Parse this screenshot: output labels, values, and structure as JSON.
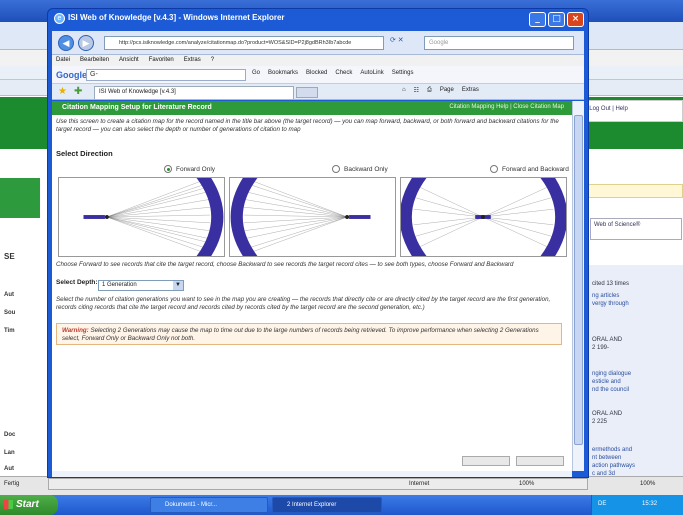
{
  "background": {
    "left_labels": [
      "SE",
      "Aut",
      "Sou",
      "Tim",
      "Doc",
      "Lan",
      "Aut"
    ],
    "right_nav": "| Log Out | Help",
    "web_of_science": "Web of Science®",
    "right_text": [
      "cited 13 times",
      "ng articles",
      "vergy through",
      "ORAL AND",
      "2 199-",
      "nging dialogue",
      "esticle and",
      "nd the council",
      "ORAL AND",
      "2 225",
      "ermethods and",
      "nt between",
      "action pathways",
      "c and 3d"
    ],
    "status_left": "Fertig",
    "status_zoom": "100%"
  },
  "popup": {
    "title": "ISI Web of Knowledge [v.4.3] - Windows Internet Explorer",
    "address": "http://pcs.isiknowledge.com/analyze/citationmap.do?product=WOS&SID=P2j8gdBRh3Ib7abcde",
    "search_placeholder": "Google",
    "menu": [
      "Datei",
      "Bearbeiten",
      "Ansicht",
      "Favoriten",
      "Extras",
      "?"
    ],
    "google_box": "G-",
    "google_items": [
      "Go",
      "Bookmarks",
      "Blocked",
      "Check",
      "AutoLink",
      "Settings"
    ],
    "tab_label": "ISI Web of Knowledge [v.4.3]",
    "tab_tools": [
      "Page",
      "Extras"
    ],
    "status_internet": "Internet",
    "status_zoom": "100%"
  },
  "citation_map": {
    "header_title": "Citation Mapping Setup for Literature Record",
    "header_links": "Citation Mapping Help | Close Citation Map",
    "intro": "Use this screen to create a citation map for the record named in the title bar above (the target record) — you can map forward, backward, or both forward and backward citations for the target record — you can also select the depth or number of generations of citation to map",
    "select_direction": "Select Direction",
    "options": {
      "forward": "Forward Only",
      "backward": "Backward Only",
      "both": "Forward and Backward"
    },
    "selected_direction": "forward",
    "choose_text": "Choose Forward to see records that cite the target record, choose Backward to see records the target record cites — to see both types, choose Forward and Backward",
    "select_depth_label": "Select Depth:",
    "depth_value": "1 Generation",
    "depth_text": "Select the number of citation generations you want to see in the map you are creating — the records that directly cite or are directly cited by the target record are the first generation, records citing records that cite the target record and records cited by records cited by the target record are the second generation, etc.)",
    "warning_label": "Warning:",
    "warning_text": "Selecting 2 Generations may cause the map to time out due to the large numbers of records being retrieved. To improve performance when selecting 2 Generations select, Forward Only or Backward Only not both."
  },
  "taskbar": {
    "start": "Start",
    "tasks": [
      "Dokument1 - Micr...",
      "2 Internet Explorer"
    ],
    "lang": "DE",
    "clock": "15:32"
  },
  "colors": {
    "accent_green": "#2f9a3a",
    "window_blue": "#1d5bd6",
    "diagram_purple": "#3a2fa0"
  }
}
